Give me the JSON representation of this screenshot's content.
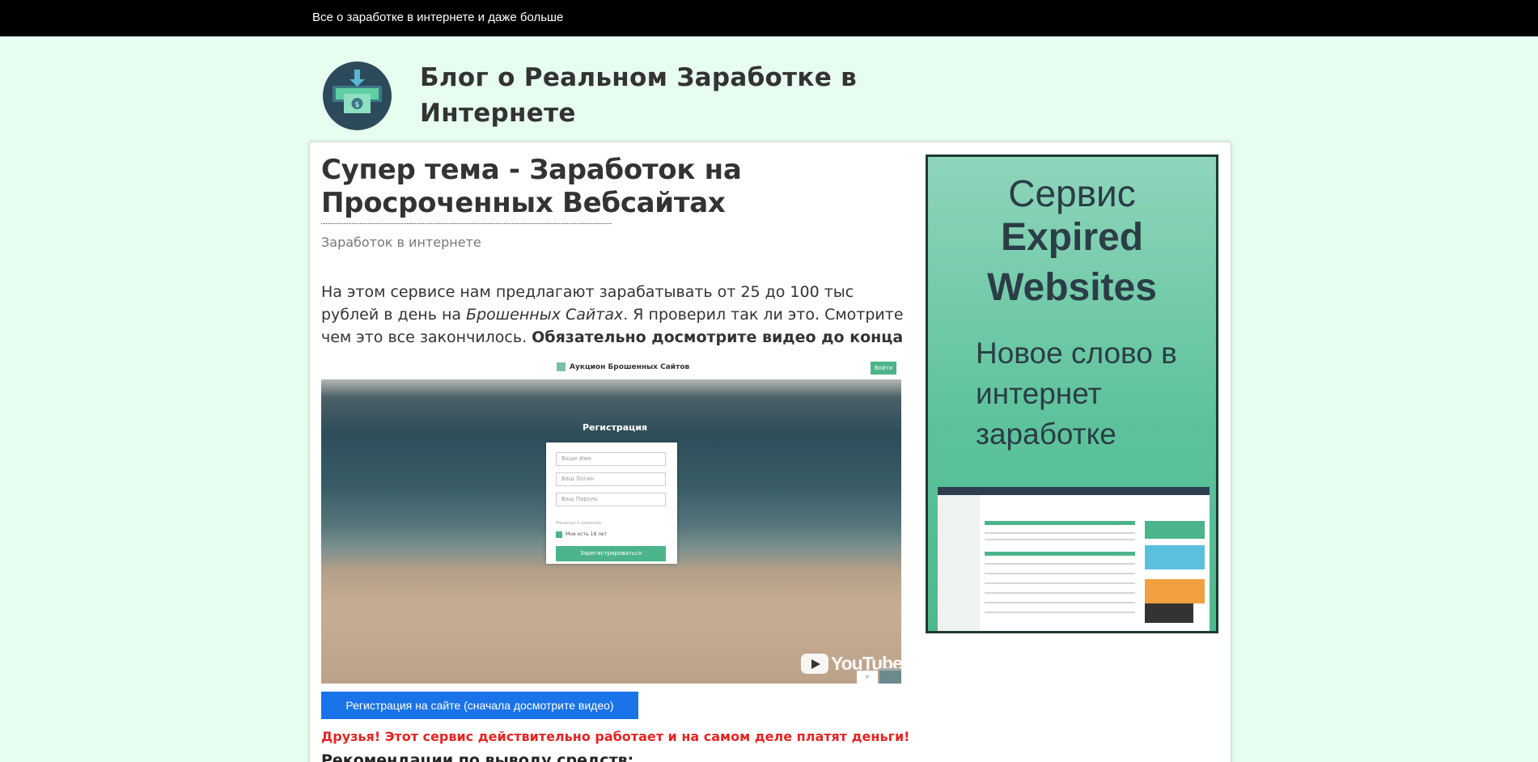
{
  "topbar": {
    "tagline": "Все о заработке в интернете и даже больше"
  },
  "header": {
    "site_title": "Блог о Реальном Заработке в Интернете"
  },
  "post": {
    "title": "Супер тема - Заработок на Просроченных Вебсайтах",
    "category": "Заработок в интернете",
    "intro_part1": "На этом сервисе нам предлагают зарабатывать от 25 до 100 тыс рублей в день на ",
    "intro_italic": "Брошенных Сайтах",
    "intro_part2": ". Я проверил так ли это. Смотрите чем это все закончилось. ",
    "intro_bold": "Обязательно досмотрите видео до конца",
    "register_button": "Регистрация на сайте (сначала досмотрите видео)",
    "notice": "Друзья! Этот сервис действительно работает и на самом деле платят деньги!",
    "subheading": "Рекомендации по выводу средств:"
  },
  "video": {
    "site_name": "Аукцион Брошенных Сайтов",
    "login_button": "Войти",
    "form_heading": "Регистрация",
    "name_placeholder": "Ваше Имя",
    "login_placeholder": "Ваш Логин",
    "password_placeholder": "Ваш Пароль",
    "password_hint": "Минимум 6 символов",
    "age_checkbox": "Мне есть 18 лет",
    "submit_button": "Зарегистрироваться",
    "platform_logo": "YouTube",
    "close_label": "×"
  },
  "banner": {
    "line1": "Сервис",
    "line2": "Expired",
    "line3": "Websites",
    "subtitle": "Новое слово в интернет заработке"
  },
  "colors": {
    "background": "#e6fdef",
    "topbar": "#000000",
    "button": "#1a73e8",
    "notice": "#e52424",
    "banner_green": "#5ec39c"
  }
}
